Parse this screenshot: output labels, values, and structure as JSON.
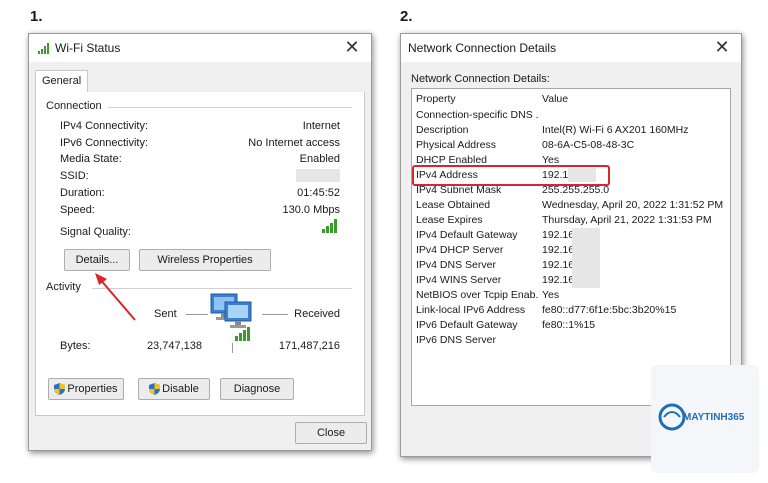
{
  "labels": {
    "one": "1.",
    "two": "2."
  },
  "wifi_status": {
    "title": "Wi-Fi Status",
    "tab_general": "General",
    "connection_header": "Connection",
    "rows": [
      {
        "label": "IPv4 Connectivity:",
        "value": "Internet"
      },
      {
        "label": "IPv6 Connectivity:",
        "value": "No Internet access"
      },
      {
        "label": "Media State:",
        "value": "Enabled"
      },
      {
        "label": "SSID:",
        "value": ""
      },
      {
        "label": "Duration:",
        "value": "01:45:52"
      },
      {
        "label": "Speed:",
        "value": "130.0 Mbps"
      }
    ],
    "signal_quality_label": "Signal Quality:",
    "details_button": "Details...",
    "wireless_properties_button": "Wireless Properties",
    "activity_header": "Activity",
    "sent_label": "Sent",
    "received_label": "Received",
    "bytes_label": "Bytes:",
    "bytes_sent": "23,747,138",
    "bytes_received": "171,487,216",
    "properties_button": "Properties",
    "disable_button": "Disable",
    "diagnose_button": "Diagnose",
    "close_button": "Close"
  },
  "network_details": {
    "title": "Network Connection Details",
    "subtitle": "Network Connection Details:",
    "col_property": "Property",
    "col_value": "Value",
    "rows": [
      {
        "property": "Connection-specific DNS ...",
        "value": ""
      },
      {
        "property": "Description",
        "value": "Intel(R) Wi-Fi 6 AX201 160MHz"
      },
      {
        "property": "Physical Address",
        "value": "08-6A-C5-08-48-3C"
      },
      {
        "property": "DHCP Enabled",
        "value": "Yes"
      },
      {
        "property": "IPv4 Address",
        "value": "192.16"
      },
      {
        "property": "IPv4 Subnet Mask",
        "value": "255.255.255.0"
      },
      {
        "property": "Lease Obtained",
        "value": "Wednesday, April 20, 2022 1:31:52 PM"
      },
      {
        "property": "Lease Expires",
        "value": "Thursday, April 21, 2022 1:31:53 PM"
      },
      {
        "property": "IPv4 Default Gateway",
        "value": "192.16"
      },
      {
        "property": "IPv4 DHCP Server",
        "value": "192.16"
      },
      {
        "property": "IPv4 DNS Server",
        "value": "192.16"
      },
      {
        "property": "IPv4 WINS Server",
        "value": "192.16"
      },
      {
        "property": "NetBIOS over Tcpip Enab...",
        "value": "Yes"
      },
      {
        "property": "Link-local IPv6 Address",
        "value": "fe80::d77:6f1e:5bc:3b20%15"
      },
      {
        "property": "IPv6 Default Gateway",
        "value": "fe80::1%15"
      },
      {
        "property": "IPv6 DNS Server",
        "value": ""
      }
    ]
  },
  "watermark": {
    "brand": "MAYTINH365"
  },
  "colors": {
    "accent_red": "#d9262e",
    "signal_green": "#3c9a2f",
    "brand_blue": "#1f6fb8"
  }
}
